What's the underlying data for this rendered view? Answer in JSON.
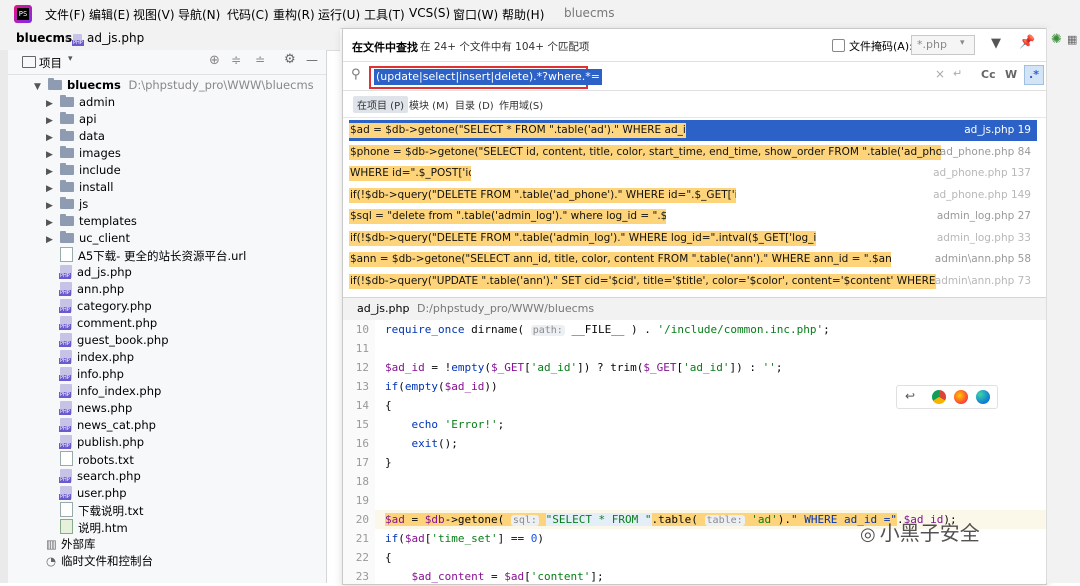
{
  "menubar": {
    "items": [
      "文件(F)",
      "编辑(E)",
      "视图(V)",
      "导航(N)",
      "代码(C)",
      "重构(R)",
      "运行(U)",
      "工具(T)",
      "VCS(S)",
      "窗口(W)",
      "帮助(H)"
    ],
    "project_name": "bluecms"
  },
  "breadcrumb": {
    "project": "bluecms",
    "file": "ad_js.php"
  },
  "project_panel": {
    "title": "项目",
    "root_name": "bluecms",
    "root_path": "D:\\phpstudy_pro\\WWW\\bluecms",
    "folders": [
      "admin",
      "api",
      "data",
      "images",
      "include",
      "install",
      "js",
      "templates",
      "uc_client"
    ],
    "files": [
      "A5下载- 更全的站长资源平台.url",
      "ad_js.php",
      "ann.php",
      "category.php",
      "comment.php",
      "guest_book.php",
      "index.php",
      "info.php",
      "info_index.php",
      "news.php",
      "news_cat.php",
      "publish.php",
      "robots.txt",
      "search.php",
      "user.php",
      "下载说明.txt",
      "说明.htm"
    ],
    "external_libs": "外部库",
    "scratches": "临时文件和控制台"
  },
  "find": {
    "title": "在文件中查找",
    "summary": "在 24+ 个文件中有 104+ 个匹配项",
    "file_mask_label": "文件掩码(A):",
    "file_mask_value": "*.php",
    "query": "(update|select|insert|delete).*?where.*=",
    "cc_label": "Cc",
    "w_label": "W",
    "regex_label": ".*",
    "scopes": [
      "在项目 (P)",
      "模块 (M)",
      "目录 (D)",
      "作用域(S)"
    ],
    "results": [
      {
        "code": "$ad = $db->getone(\"SELECT * FROM \".table('ad').\" WHERE ad_id =\".$ad_id);",
        "loc": "ad_js.php 19"
      },
      {
        "code": "$phone = $db->getone(\"SELECT id, content, title, color, start_time, end_time, show_order FROM \".table('ad_phone').",
        "loc": "ad_phone.php 84"
      },
      {
        "code": " WHERE id=\".$_POST['id'])",
        "loc": "ad_phone.php 137"
      },
      {
        "code": "if(!$db->query(\"DELETE FROM \".table('ad_phone').\" WHERE id=\".$_GET['id']))",
        "loc": "ad_phone.php 149"
      },
      {
        "code": "$sql = \"delete from \".table('admin_log').\" where log_id = \".$val;",
        "loc": "admin_log.php 27"
      },
      {
        "code": "if(!$db->query(\"DELETE FROM \".table('admin_log').\" WHERE log_id=\".intval($_GET['log_id']))){",
        "loc": "admin_log.php 33"
      },
      {
        "code": "$ann = $db->getone(\"SELECT ann_id, title, color, content FROM \".table('ann').\" WHERE ann_id = \".$ann_id);",
        "loc": "admin\\ann.php 58"
      },
      {
        "code": "if(!$db->query(\"UPDATE \".table('ann').\" SET cid='$cid', title='$title', color='$color', content='$content' WHERE ann_i",
        "loc": "admin\\ann.php 73"
      }
    ]
  },
  "editor": {
    "file": "ad_js.php",
    "path": "D:/phpstudy_pro/WWW/bluecms",
    "lines": [
      10,
      11,
      12,
      13,
      14,
      15,
      16,
      17,
      18,
      19,
      20,
      21,
      22,
      23
    ]
  },
  "watermark": "小黑子安全"
}
